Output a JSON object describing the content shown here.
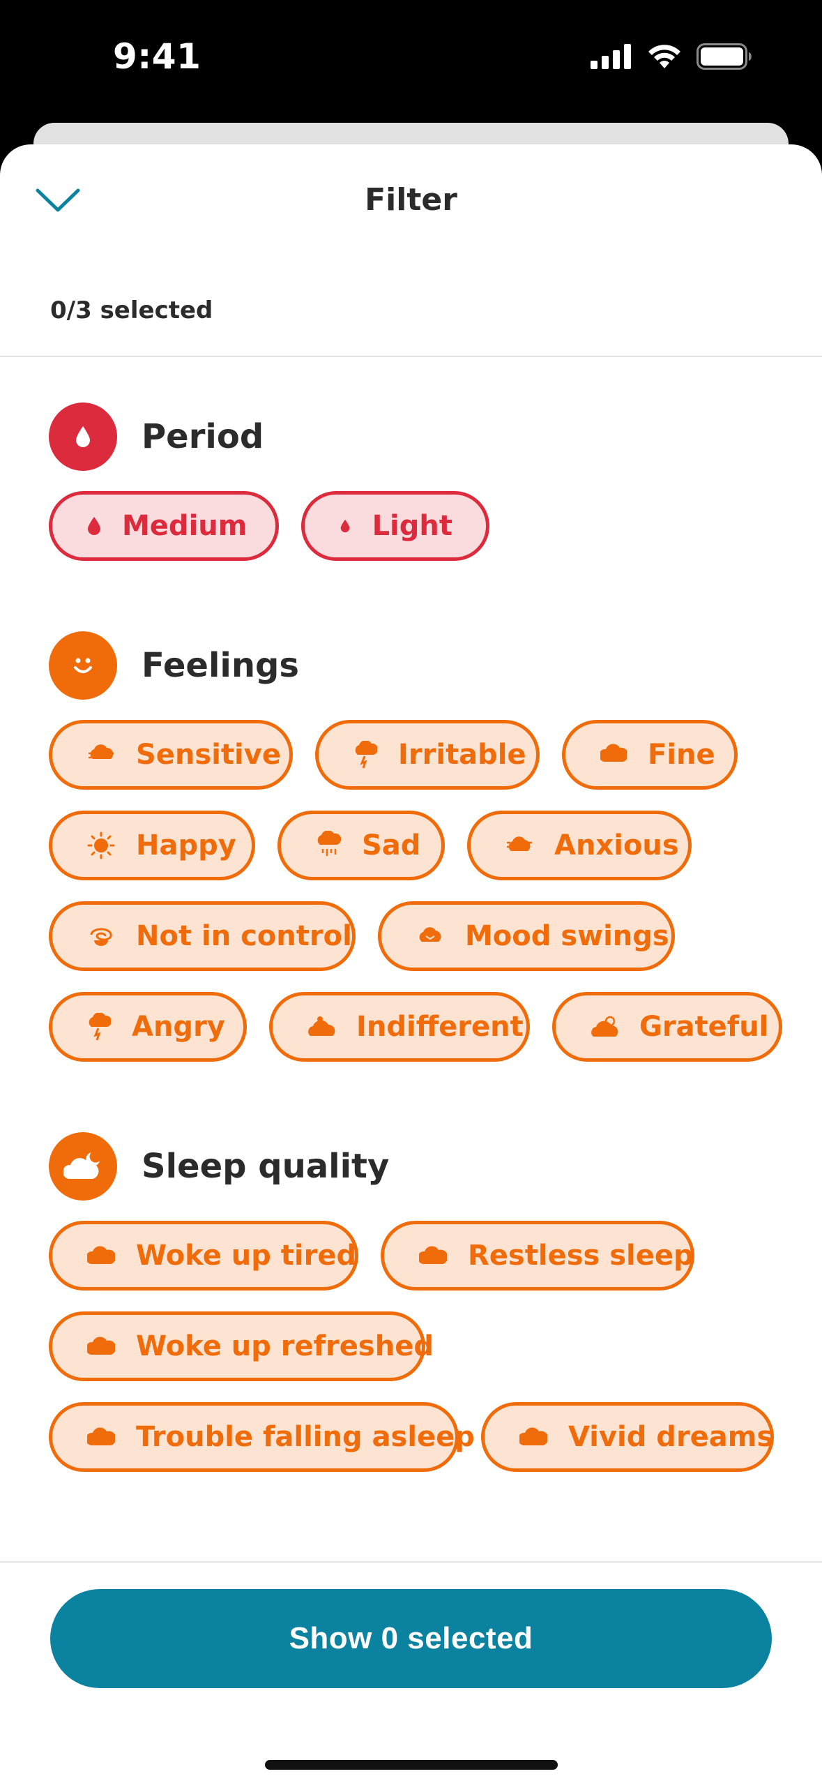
{
  "status_bar": {
    "time": "9:41"
  },
  "header": {
    "title": "Filter",
    "selected_count": "0/3 selected"
  },
  "colors": {
    "accent": "#0a82a0",
    "period_red": "#dc2b3c",
    "feelings_orange": "#f06c0b"
  },
  "sections": [
    {
      "title": "Period",
      "icon": "blood-drop-icon",
      "chips": [
        {
          "label": "Medium",
          "icon": "blood-drop-icon"
        },
        {
          "label": "Light",
          "icon": "small-blood-drop-icon"
        }
      ]
    },
    {
      "title": "Feelings",
      "icon": "smiley-face-icon",
      "chips": [
        {
          "label": "Sensitive",
          "icon": "sensitive-mood-icon"
        },
        {
          "label": "Irritable",
          "icon": "irritable-mood-icon"
        },
        {
          "label": "Fine",
          "icon": "fine-mood-icon"
        },
        {
          "label": "Happy",
          "icon": "happy-sun-icon"
        },
        {
          "label": "Sad",
          "icon": "sad-rain-cloud-icon"
        },
        {
          "label": "Anxious",
          "icon": "anxious-mood-icon"
        },
        {
          "label": "Not in control",
          "icon": "swirl-mood-icon"
        },
        {
          "label": "Mood swings",
          "icon": "mood-swings-icon"
        },
        {
          "label": "Angry",
          "icon": "angry-lightning-icon"
        },
        {
          "label": "Indifferent",
          "icon": "indifferent-mood-icon"
        },
        {
          "label": "Grateful",
          "icon": "grateful-mood-icon"
        }
      ]
    },
    {
      "title": "Sleep quality",
      "icon": "sleep-cloud-moon-icon",
      "chips": [
        {
          "label": "Woke up tired",
          "icon": "tired-cloud-icon"
        },
        {
          "label": "Restless sleep",
          "icon": "restless-cloud-icon"
        },
        {
          "label": "Woke up refreshed",
          "icon": "refreshed-cloud-icon"
        },
        {
          "label": "Trouble falling asleep",
          "icon": "trouble-sleep-cloud-icon"
        },
        {
          "label": "Vivid dreams",
          "icon": "dream-cloud-icon"
        }
      ]
    }
  ],
  "footer": {
    "button_label": "Show 0 selected"
  }
}
